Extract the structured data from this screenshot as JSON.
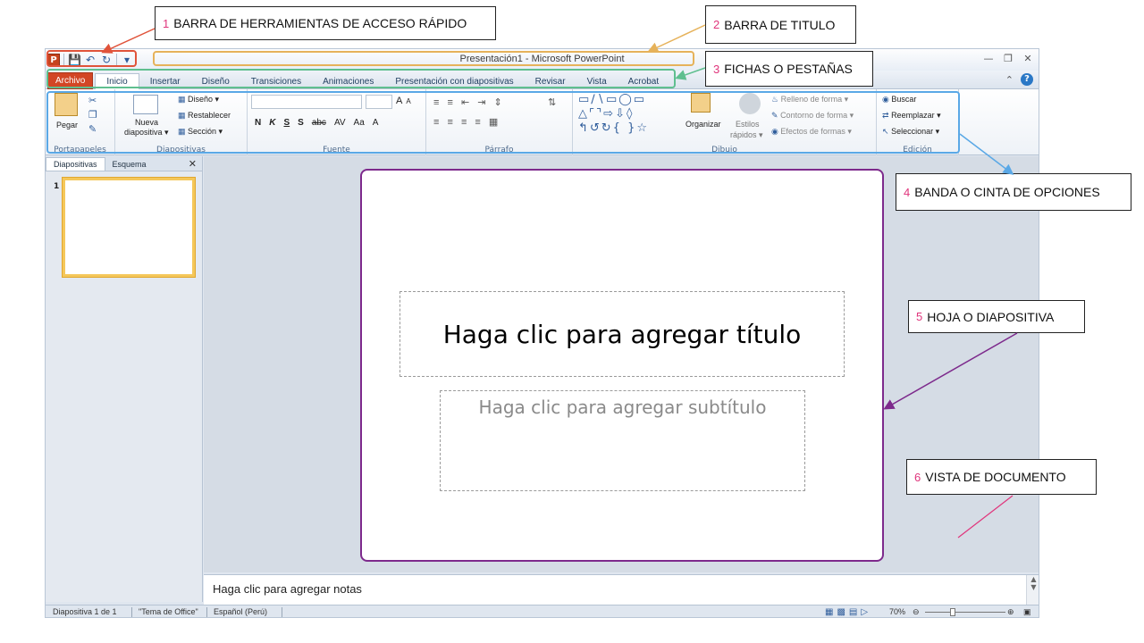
{
  "window": {
    "title": "Presentación1 - Microsoft PowerPoint",
    "qat": {
      "logo": "P",
      "save_icon": "save-icon",
      "undo_icon": "undo-icon",
      "redo_icon": "redo-icon",
      "customize_icon": "customize-qat-icon"
    }
  },
  "tabs": [
    {
      "label": "Archivo"
    },
    {
      "label": "Inicio"
    },
    {
      "label": "Insertar"
    },
    {
      "label": "Diseño"
    },
    {
      "label": "Transiciones"
    },
    {
      "label": "Animaciones"
    },
    {
      "label": "Presentación con diapositivas"
    },
    {
      "label": "Revisar"
    },
    {
      "label": "Vista"
    },
    {
      "label": "Acrobat"
    }
  ],
  "ribbon": {
    "clipboard": {
      "paste": "Pegar",
      "label": "Portapapeles"
    },
    "slides": {
      "new_slide_1": "Nueva",
      "new_slide_2": "diapositiva ▾",
      "layout": "Diseño ▾",
      "reset": "Restablecer",
      "section": "Sección ▾",
      "label": "Diapositivas"
    },
    "font": {
      "label": "Fuente",
      "bold": "N",
      "italic": "K",
      "underline": "S",
      "shadow": "S",
      "strike": "abc",
      "spacing": "AV",
      "case": "Aa",
      "color": "A",
      "grow": "A",
      "shrink": "A"
    },
    "paragraph": {
      "label": "Párrafo"
    },
    "drawing": {
      "arrange": "Organizar",
      "quick_styles_1": "Estilos",
      "quick_styles_2": "rápidos ▾",
      "shape_fill": "Relleno de forma ▾",
      "shape_outline": "Contorno de forma ▾",
      "shape_effects": "Efectos de formas ▾",
      "label": "Dibujo"
    },
    "editing": {
      "find": "Buscar",
      "replace": "Reemplazar ▾",
      "select": "Seleccionar ▾",
      "label": "Edición"
    }
  },
  "leftpanel": {
    "tab_slides": "Diapositivas",
    "tab_outline": "Esquema",
    "close": "✕",
    "thumb_number": "1"
  },
  "slide": {
    "title_placeholder": "Haga clic para agregar título",
    "subtitle_placeholder": "Haga clic para agregar subtítulo"
  },
  "notes": {
    "placeholder": "Haga clic para agregar notas"
  },
  "statusbar": {
    "slide_info": "Diapositiva 1 de 1",
    "theme": "\"Tema de Office\"",
    "language": "Español (Perú)",
    "zoom": "70%"
  },
  "annotations": [
    {
      "num": "1",
      "text": "BARRA DE HERRAMIENTAS DE ACCESO RÁPIDO"
    },
    {
      "num": "2",
      "text": "BARRA DE TITULO"
    },
    {
      "num": "3",
      "text": "FICHAS O PESTAÑAS"
    },
    {
      "num": "4",
      "text": "BANDA O CINTA DE OPCIONES"
    },
    {
      "num": "5",
      "text": "HOJA O DIAPOSITIVA"
    },
    {
      "num": "6",
      "text": "VISTA DE DOCUMENTO"
    }
  ],
  "colors": {
    "file_tab": "#d24625",
    "slide_border": "#7d2a8c",
    "annotation_number": "#e0357c",
    "qat_highlight": "#e0533a",
    "title_highlight": "#e6b25a",
    "tabs_highlight": "#5fbf8f",
    "ribbon_highlight": "#5aa8e6"
  }
}
